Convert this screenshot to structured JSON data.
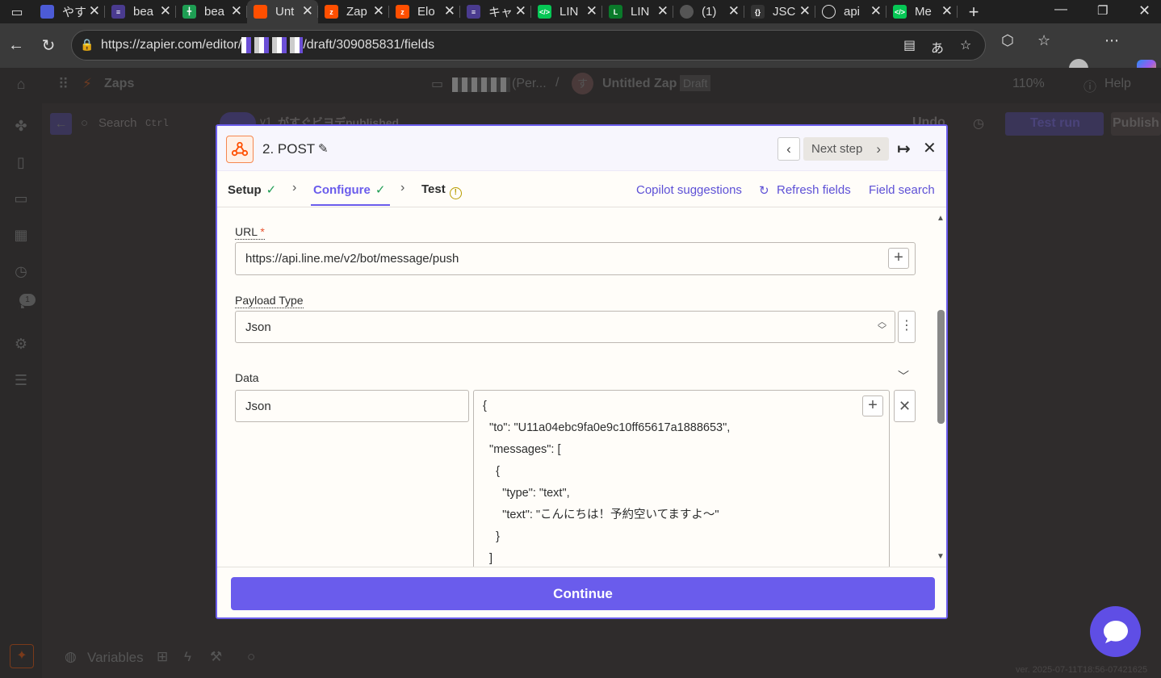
{
  "browser": {
    "tabs": [
      {
        "title": "やす",
        "color": "#4c5bd6"
      },
      {
        "title": "bea",
        "color": "#4a3b8f"
      },
      {
        "title": "bea",
        "color": "#1e9e53"
      },
      {
        "title": "Unt",
        "color": "#ff4f00",
        "active": true
      },
      {
        "title": "Zap",
        "color": "#ff4f00"
      },
      {
        "title": "Elo",
        "color": "#ff4f00"
      },
      {
        "title": "キャ",
        "color": "#4a3b8f"
      },
      {
        "title": "LIN",
        "color": "#06c755"
      },
      {
        "title": "LIN",
        "color": "#0a7a2a"
      },
      {
        "title": "(1)",
        "color": "#555555"
      },
      {
        "title": "JSC",
        "color": "#333333"
      },
      {
        "title": "api",
        "color": "#666666"
      },
      {
        "title": "Me",
        "color": "#06c755"
      }
    ],
    "url_prefix": "https://zapier.com/editor/",
    "url_suffix": "/draft/309085831/fields"
  },
  "app": {
    "zaps_label": "Zaps",
    "folder_label": "(Per...",
    "zap_name": "Untitled Zap",
    "draft_badge": "Draft",
    "zoom": "110%",
    "help_label": "Help",
    "search_label": "Search",
    "search_shortcut": "Ctrl",
    "version_label": "v1",
    "version_status": "がすぐビヨデpublished",
    "undo_label": "Undo",
    "test_run_label": "Test run",
    "publish_label": "Publish",
    "variables_label": "Variables",
    "version_footer": "ver. 2025-07-11T18:56-07421625"
  },
  "modal": {
    "title": "2. POST",
    "next_step_label": "Next step",
    "tabs": [
      {
        "label": "Setup",
        "state": "done"
      },
      {
        "label": "Configure",
        "state": "done",
        "active": true
      },
      {
        "label": "Test",
        "state": "warning"
      }
    ],
    "links": {
      "copilot": "Copilot suggestions",
      "refresh": "Refresh fields",
      "field_search": "Field search"
    },
    "fields": {
      "url_label": "URL",
      "url_required": "*",
      "url_value": "https://api.line.me/v2/bot/message/push",
      "payload_label": "Payload Type",
      "payload_value": "Json",
      "data_label": "Data",
      "data_key": "Json",
      "data_value_lines": [
        "{",
        "  \"to\": \"U11a04ebc9fa0e9c10ff65617a1888653\",",
        "  \"messages\": [",
        "    {",
        "      \"type\": \"text\",",
        "      \"text\": \"こんにちは！予約空いてますよ〜\"",
        "    }",
        "  ]"
      ]
    },
    "continue_label": "Continue"
  },
  "colors": {
    "accent": "#6a5cec",
    "zapier_orange": "#ff4f00",
    "success": "#1f9d55"
  }
}
